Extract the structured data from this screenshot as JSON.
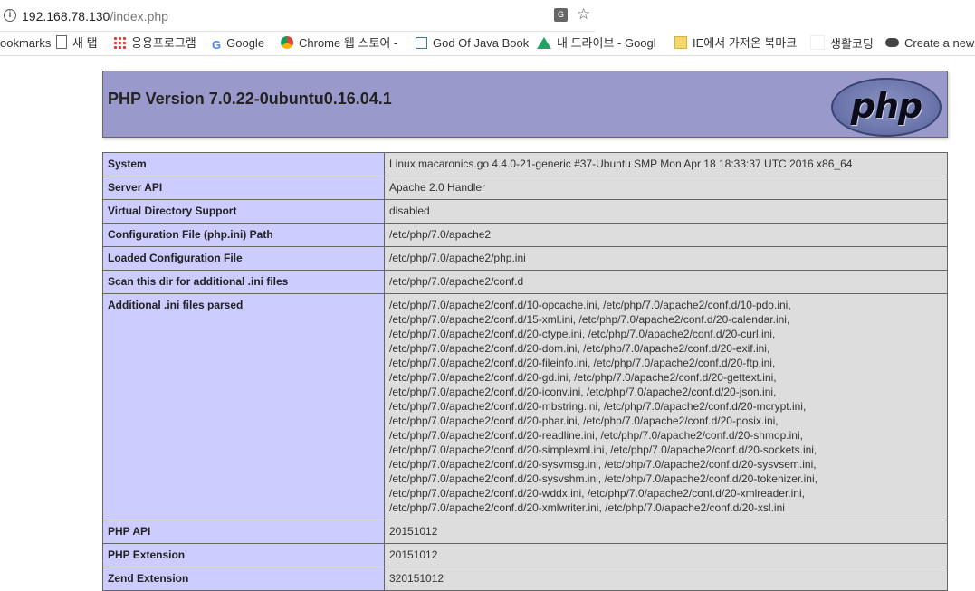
{
  "browser": {
    "url_host": "192.168.78.130",
    "url_path": "/index.php",
    "translate_icon": "translate-icon",
    "star_icon": "star-icon"
  },
  "bookmarks": [
    {
      "label": "ookmarks",
      "icon": ""
    },
    {
      "label": "새 탭",
      "icon": "page-icon"
    },
    {
      "label": "응용프로그램",
      "icon": "apps-icon"
    },
    {
      "label": "Google",
      "icon": "google-icon"
    },
    {
      "label": "Chrome 웹 스토어 -",
      "icon": "chrome-icon"
    },
    {
      "label": "God Of Java Book",
      "icon": "book-icon"
    },
    {
      "label": "내 드라이브 - Googl",
      "icon": "drive-icon"
    },
    {
      "label": "IE에서 가져온 북마크",
      "icon": "folder-icon"
    },
    {
      "label": "생활코딩",
      "icon": "blank-icon"
    },
    {
      "label": "Create a new",
      "icon": "cloud-icon"
    }
  ],
  "php": {
    "title": "PHP Version 7.0.22-0ubuntu0.16.04.1",
    "logo_text": "php"
  },
  "rows": [
    {
      "key": "System",
      "value": "Linux macaronics.go 4.4.0-21-generic #37-Ubuntu SMP Mon Apr 18 18:33:37 UTC 2016 x86_64"
    },
    {
      "key": "Server API",
      "value": "Apache 2.0 Handler"
    },
    {
      "key": "Virtual Directory Support",
      "value": "disabled"
    },
    {
      "key": "Configuration File (php.ini) Path",
      "value": "/etc/php/7.0/apache2"
    },
    {
      "key": "Loaded Configuration File",
      "value": "/etc/php/7.0/apache2/php.ini"
    },
    {
      "key": "Scan this dir for additional .ini files",
      "value": "/etc/php/7.0/apache2/conf.d"
    }
  ],
  "additional_ini": {
    "key": "Additional .ini files parsed",
    "lines": [
      "/etc/php/7.0/apache2/conf.d/10-opcache.ini, /etc/php/7.0/apache2/conf.d/10-pdo.ini,",
      "/etc/php/7.0/apache2/conf.d/15-xml.ini, /etc/php/7.0/apache2/conf.d/20-calendar.ini,",
      "/etc/php/7.0/apache2/conf.d/20-ctype.ini, /etc/php/7.0/apache2/conf.d/20-curl.ini,",
      "/etc/php/7.0/apache2/conf.d/20-dom.ini, /etc/php/7.0/apache2/conf.d/20-exif.ini,",
      "/etc/php/7.0/apache2/conf.d/20-fileinfo.ini, /etc/php/7.0/apache2/conf.d/20-ftp.ini,",
      "/etc/php/7.0/apache2/conf.d/20-gd.ini, /etc/php/7.0/apache2/conf.d/20-gettext.ini,",
      "/etc/php/7.0/apache2/conf.d/20-iconv.ini, /etc/php/7.0/apache2/conf.d/20-json.ini,",
      "/etc/php/7.0/apache2/conf.d/20-mbstring.ini, /etc/php/7.0/apache2/conf.d/20-mcrypt.ini,",
      "/etc/php/7.0/apache2/conf.d/20-phar.ini, /etc/php/7.0/apache2/conf.d/20-posix.ini,",
      "/etc/php/7.0/apache2/conf.d/20-readline.ini, /etc/php/7.0/apache2/conf.d/20-shmop.ini,",
      "/etc/php/7.0/apache2/conf.d/20-simplexml.ini, /etc/php/7.0/apache2/conf.d/20-sockets.ini,",
      "/etc/php/7.0/apache2/conf.d/20-sysvmsg.ini, /etc/php/7.0/apache2/conf.d/20-sysvsem.ini,",
      "/etc/php/7.0/apache2/conf.d/20-sysvshm.ini, /etc/php/7.0/apache2/conf.d/20-tokenizer.ini,",
      "/etc/php/7.0/apache2/conf.d/20-wddx.ini, /etc/php/7.0/apache2/conf.d/20-xmlreader.ini,",
      "/etc/php/7.0/apache2/conf.d/20-xmlwriter.ini, /etc/php/7.0/apache2/conf.d/20-xsl.ini"
    ]
  },
  "rows_after": [
    {
      "key": "PHP API",
      "value": "20151012"
    },
    {
      "key": "PHP Extension",
      "value": "20151012"
    },
    {
      "key": "Zend Extension",
      "value": "320151012"
    }
  ]
}
